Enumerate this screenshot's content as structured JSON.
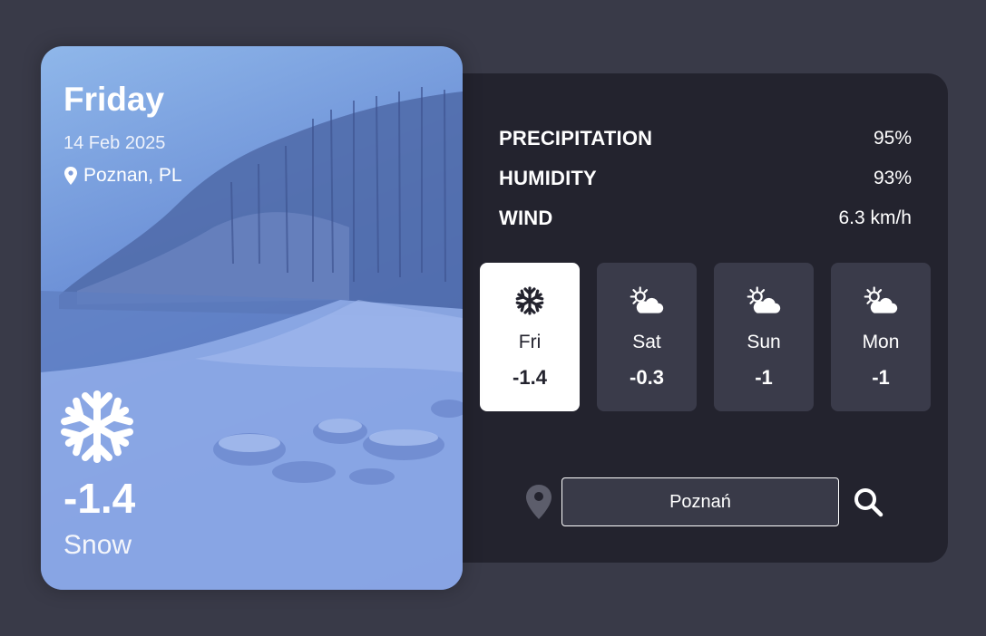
{
  "current": {
    "day": "Friday",
    "date": "14 Feb 2025",
    "location": "Poznan, PL",
    "temperature": "-1.4",
    "condition": "Snow",
    "icon": "snowflake-icon"
  },
  "stats": [
    {
      "label": "PRECIPITATION",
      "value": "95%"
    },
    {
      "label": "HUMIDITY",
      "value": "93%"
    },
    {
      "label": "WIND",
      "value": "6.3 km/h"
    }
  ],
  "forecast": [
    {
      "day": "Fri",
      "temp": "-1.4",
      "icon": "snowflake-icon",
      "active": true
    },
    {
      "day": "Sat",
      "temp": "-0.3",
      "icon": "partly-cloudy-icon",
      "active": false
    },
    {
      "day": "Sun",
      "temp": "-1",
      "icon": "partly-cloudy-icon",
      "active": false
    },
    {
      "day": "Mon",
      "temp": "-1",
      "icon": "partly-cloudy-icon",
      "active": false
    }
  ],
  "search": {
    "value": "Poznań",
    "icon": "search-icon"
  },
  "colors": {
    "background": "#393a48",
    "panel": "#23232e",
    "card": "#3a3b4a",
    "active_card": "#ffffff"
  }
}
